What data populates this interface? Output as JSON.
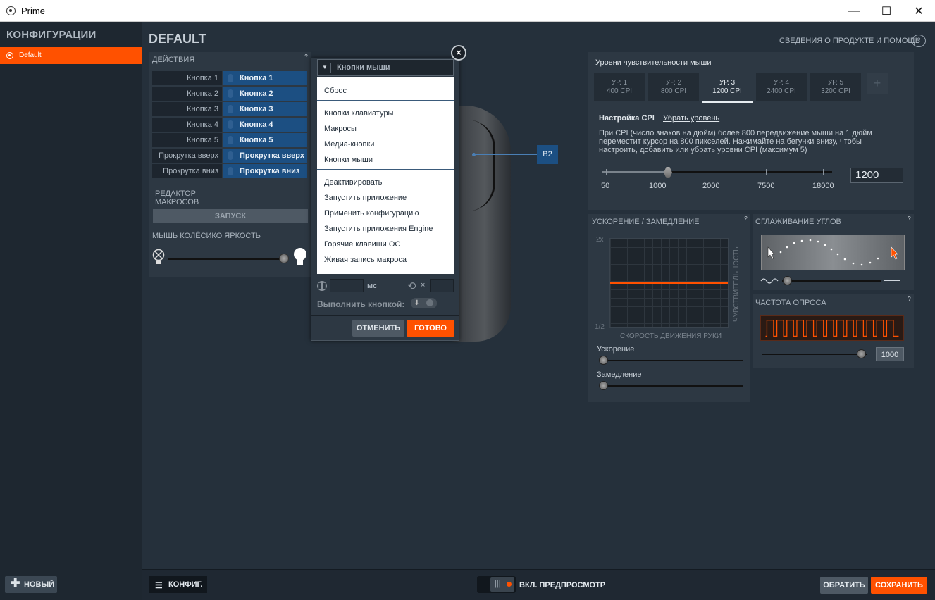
{
  "window": {
    "title": "Prime",
    "minimize": "—",
    "maximize": "☐",
    "close": "✕"
  },
  "sidebar": {
    "header": "КОНФИГУРАЦИИ",
    "configs": [
      "Default"
    ],
    "new_button": "НОВЫЙ"
  },
  "page": {
    "title": "DEFAULT",
    "help_link": "СВЕДЕНИЯ О ПРОДУКТЕ И ПОМОЩЬ"
  },
  "actions": {
    "title": "ДЕЙСТВИЯ",
    "rows": [
      {
        "label": "Кнопка 1",
        "value": "Кнопка 1"
      },
      {
        "label": "Кнопка 2",
        "value": "Кнопка 2"
      },
      {
        "label": "Кнопка 3",
        "value": "Кнопка 3"
      },
      {
        "label": "Кнопка 4",
        "value": "Кнопка 4"
      },
      {
        "label": "Кнопка 5",
        "value": "Кнопка 5"
      },
      {
        "label": "Прокрутка вверх",
        "value": "Прокрутка вверх"
      },
      {
        "label": "Прокрутка вниз",
        "value": "Прокрутка вниз"
      }
    ],
    "macro_editor_line1": "РЕДАКТОР",
    "macro_editor_line2": "МАКРОСОВ",
    "run_button": "ЗАПУСК",
    "wheel_brightness": "МЫШЬ КОЛЁСИКО ЯРКОСТЬ"
  },
  "mouse": {
    "callout": "B2"
  },
  "popup": {
    "dropdown_value": "Кнопки мыши",
    "menu": [
      "Сброс",
      "Кнопки клавиатуры",
      "Макросы",
      "Медиа-кнопки",
      "Кнопки мыши",
      "Деактивировать",
      "Запустить приложение",
      "Применить конфигурацию",
      "Запустить приложения Engine",
      "Горячие клавиши ОС",
      "Живая запись макроса"
    ],
    "ms_label": "мс",
    "times_label": "×",
    "exec_label": "Выполнить кнопкой:",
    "cancel": "ОТМЕНИТЬ",
    "ok": "ГОТОВО"
  },
  "cpi": {
    "title": "Уровни чувствительности мыши",
    "tabs": [
      {
        "level": "УР. 1",
        "cpi": "400 CPI"
      },
      {
        "level": "УР. 2",
        "cpi": "800 CPI"
      },
      {
        "level": "УР. 3",
        "cpi": "1200 CPI"
      },
      {
        "level": "УР. 4",
        "cpi": "2400 CPI"
      },
      {
        "level": "УР. 5",
        "cpi": "3200 CPI"
      }
    ],
    "active_tab": 2,
    "add": "+",
    "settings_label": "Настройка CPI",
    "remove_level": "Убрать уровень",
    "description": "При CPI (число знаков на дюйм) более 800 передвижение мыши на 1 дюйм переместит курсор на 800 пикселей. Нажимайте на бегунки внизу, чтобы настроить, добавить или убрать уровни CPI (максимум 5)",
    "ticks": [
      "50",
      "1000",
      "2000",
      "7500",
      "18000"
    ],
    "value": "1200"
  },
  "accel": {
    "title": "УСКОРЕНИЕ / ЗАМЕДЛЕНИЕ",
    "y_top": "2x",
    "y_bottom": "1/2",
    "y_axis": "ЧУВСТВИТЕЛЬНОСТЬ",
    "x_axis": "СКОРОСТЬ ДВИЖЕНИЯ РУКИ",
    "accel_label": "Ускорение",
    "decel_label": "Замедление"
  },
  "angle": {
    "title": "СГЛАЖИВАНИЕ УГЛОВ"
  },
  "poll": {
    "title": "ЧАСТОТА ОПРОСА",
    "value": "1000"
  },
  "bottom": {
    "config_button": "КОНФИГ.",
    "preview": "ВКЛ. ПРЕДПРОСМОТР",
    "revert": "ОБРАТИТЬ",
    "save": "СОХРАНИТЬ"
  },
  "colors": {
    "accent": "#ff5100",
    "button_blue": "#1c4f82",
    "panel": "#2d3843",
    "background": "#25303b"
  }
}
